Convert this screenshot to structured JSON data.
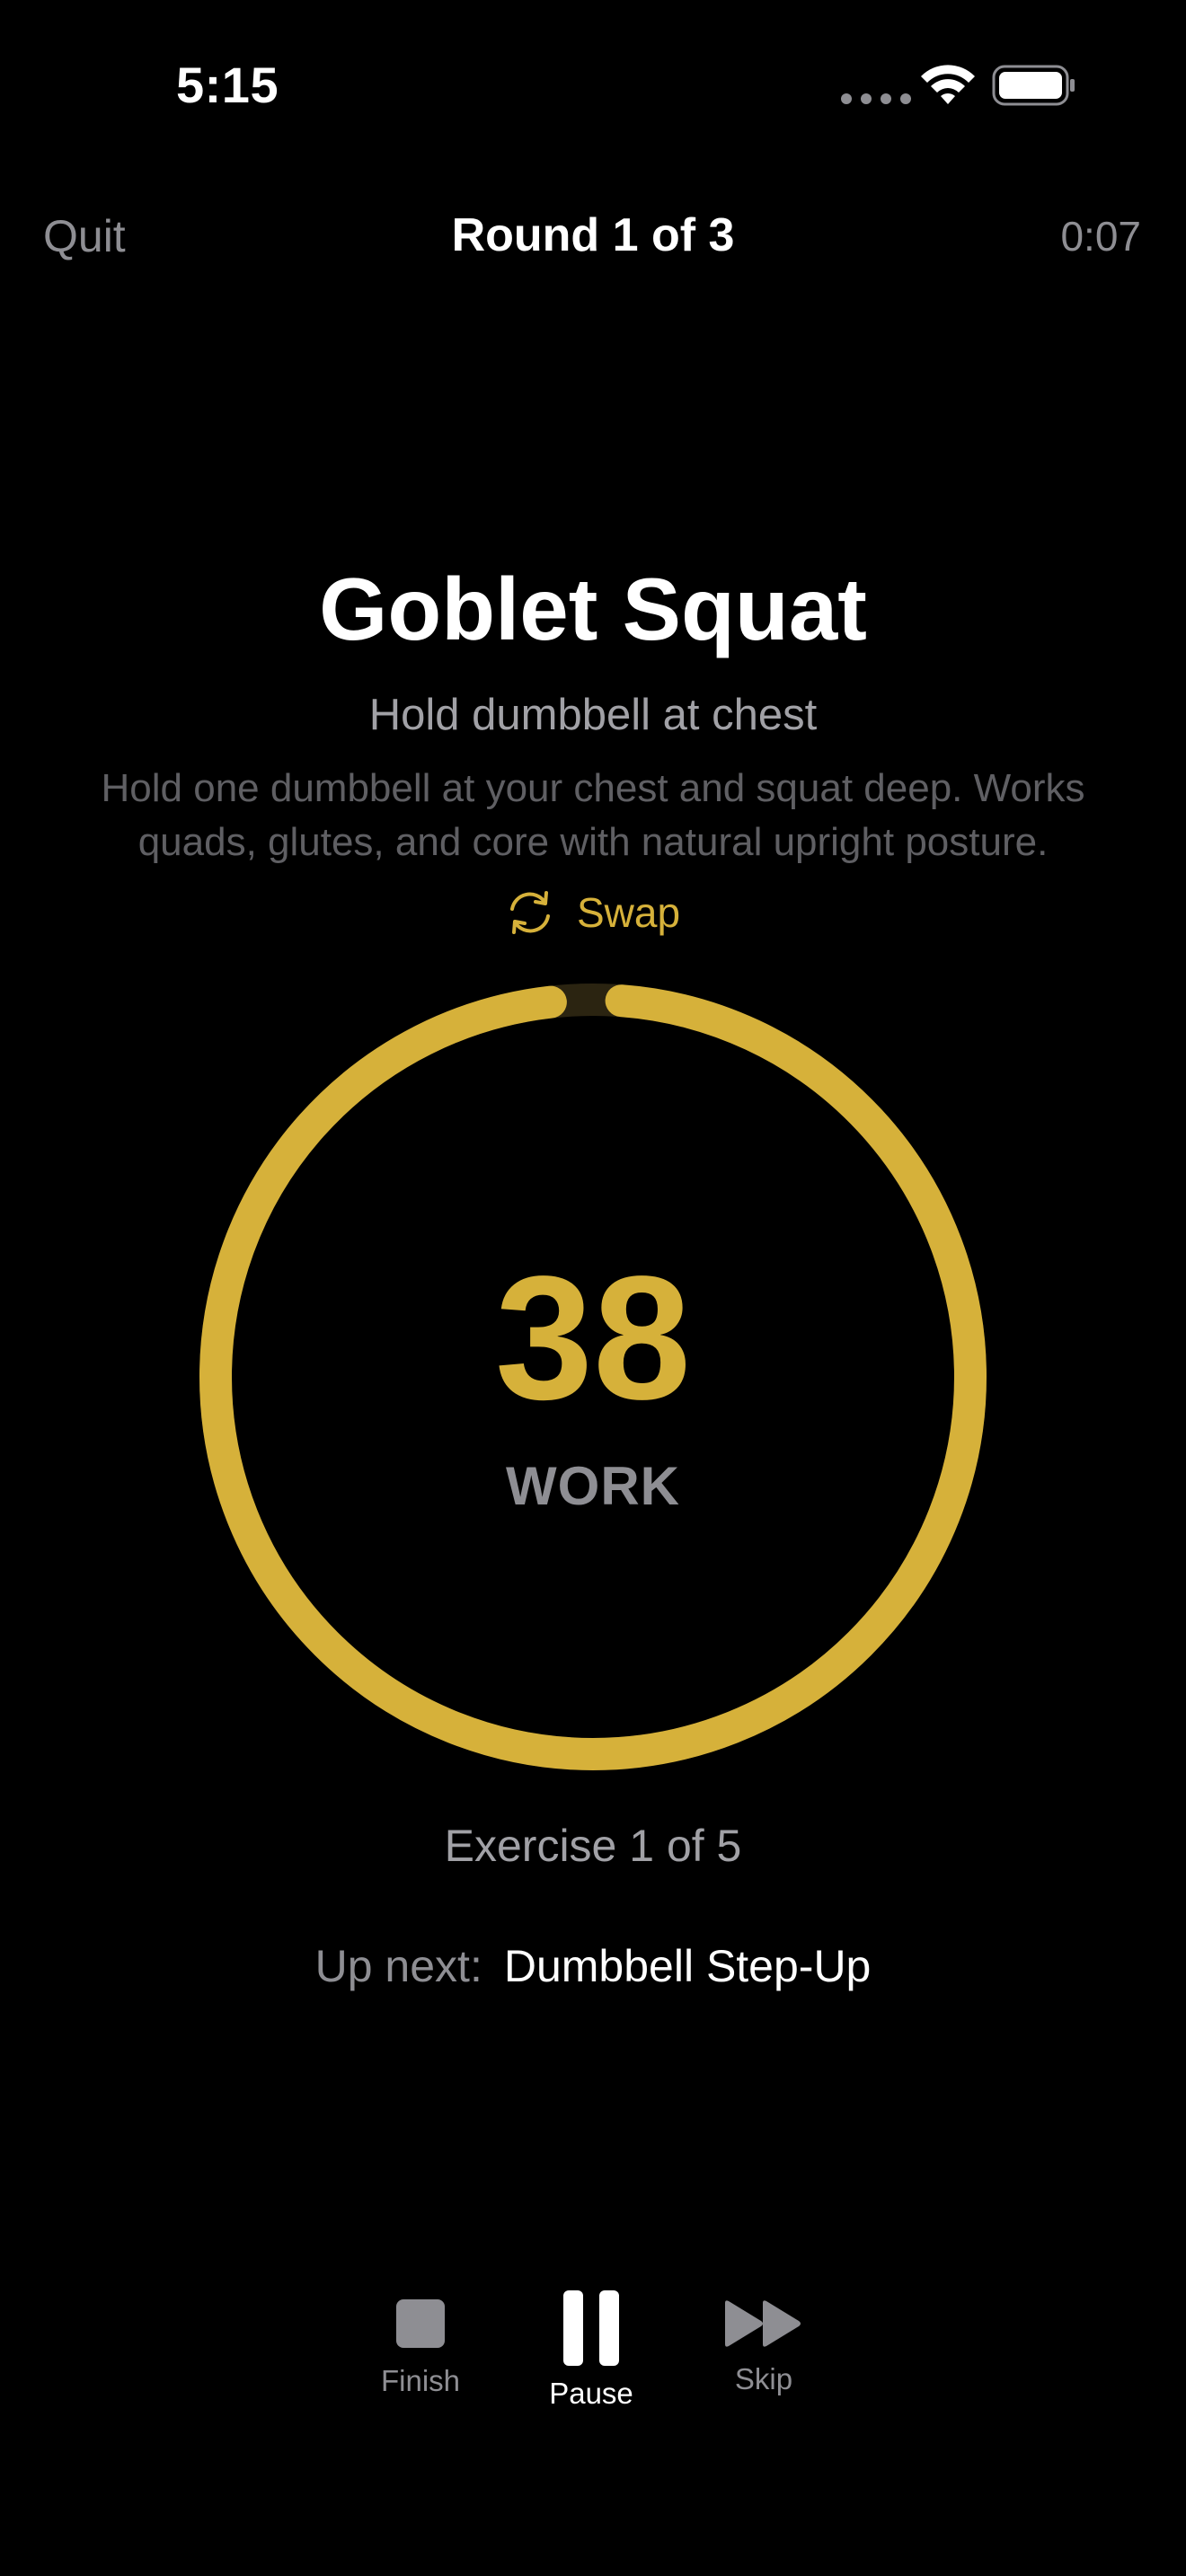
{
  "status_bar": {
    "time": "5:15",
    "signal_icon": "cellular-dots-icon",
    "wifi_icon": "wifi-icon",
    "battery_icon": "battery-icon"
  },
  "nav": {
    "quit_label": "Quit",
    "round_label": "Round 1 of 3",
    "elapsed": "0:07"
  },
  "exercise": {
    "name": "Goblet Squat",
    "cue": "Hold dumbbell at chest",
    "description": "Hold one dumbbell at your chest and squat deep. Works quads, glutes, and core with natural upright posture.",
    "swap_label": "Swap",
    "swap_icon": "swap-arrows-icon"
  },
  "timer": {
    "value": "38",
    "phase": "WORK",
    "ring_progress": 0.97
  },
  "progress": {
    "exercise_label": "Exercise 1 of 5"
  },
  "up_next": {
    "label": "Up next:",
    "value": "Dumbbell Step-Up"
  },
  "controls": {
    "finish_label": "Finish",
    "pause_label": "Pause",
    "skip_label": "Skip"
  },
  "colors": {
    "accent": "#d6b13a",
    "background": "#000000",
    "secondary_text": "#8e8e93"
  }
}
